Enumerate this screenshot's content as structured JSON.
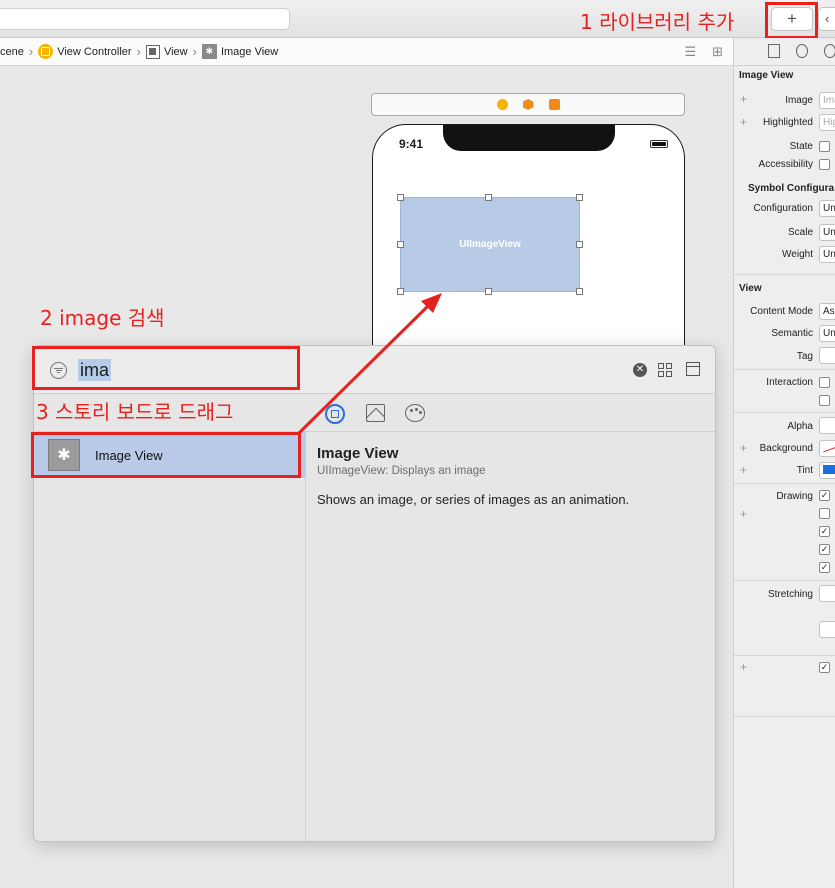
{
  "annotations": {
    "step1": "1 라이브러리 추가",
    "step2": "2 image 검색",
    "step3": "3 스토리 보드로 드래그"
  },
  "toolbar": {
    "library_button": "+",
    "back_button": "‹"
  },
  "breadcrumb": {
    "items": [
      "cene",
      "View Controller",
      "View",
      "Image View"
    ]
  },
  "canvas": {
    "status_time": "9:41",
    "image_view_label": "UIImageView"
  },
  "library": {
    "search_value": "ima",
    "clear_glyph": "✕",
    "results": [
      {
        "label": "Image View"
      }
    ],
    "detail": {
      "title": "Image View",
      "subtitle": "UIImageView: Displays an image",
      "description": "Shows an image, or series of images as an animation."
    }
  },
  "inspector": {
    "image_view_section": "Image View",
    "image_label": "Image",
    "image_placeholder": "Imag",
    "highlighted_label": "Highlighted",
    "highlighted_placeholder": "High",
    "state_label": "State",
    "accessibility_label": "Accessibility",
    "symbol_section": "Symbol Configura",
    "configuration_label": "Configuration",
    "configuration_value": "Un",
    "scale_label": "Scale",
    "scale_value": "Un",
    "weight_label": "Weight",
    "weight_value": "Un",
    "view_section": "View",
    "content_mode_label": "Content Mode",
    "content_mode_value": "As",
    "semantic_label": "Semantic",
    "semantic_value": "Un",
    "tag_label": "Tag",
    "interaction_label": "Interaction",
    "alpha_label": "Alpha",
    "background_label": "Background",
    "tint_label": "Tint",
    "drawing_label": "Drawing",
    "stretching_label": "Stretching",
    "check_glyph": "✓"
  }
}
